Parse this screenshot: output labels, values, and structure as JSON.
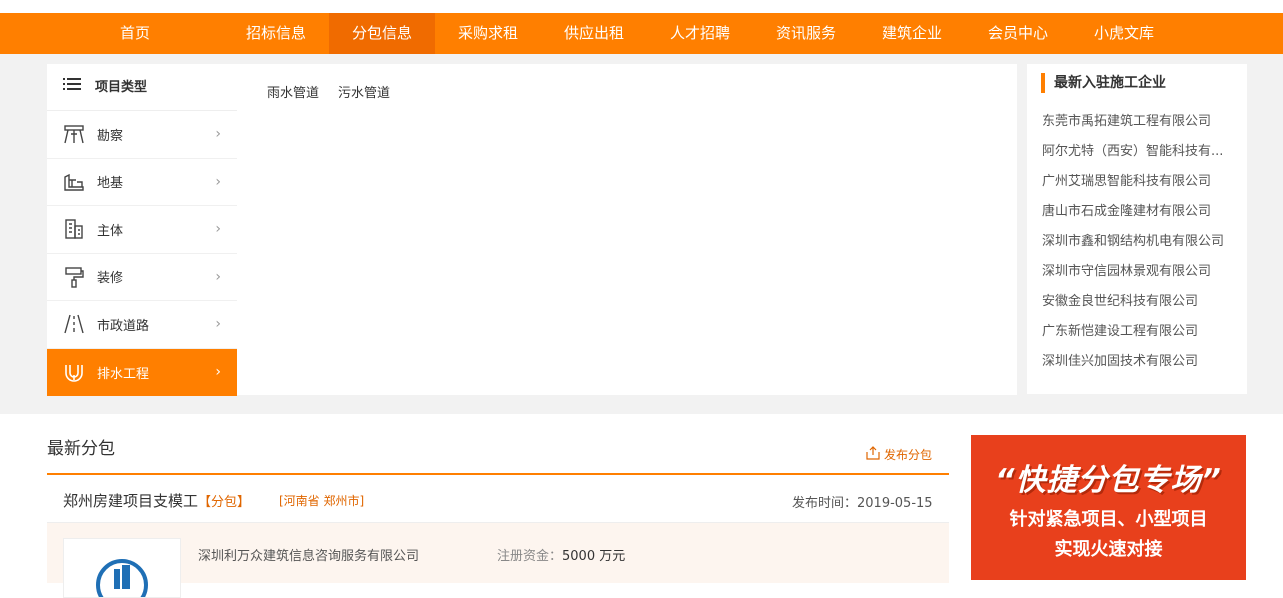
{
  "nav": {
    "items": [
      "首页",
      "招标信息",
      "分包信息",
      "采购求租",
      "供应出租",
      "人才招聘",
      "资讯服务",
      "建筑企业",
      "会员中心",
      "小虎文库"
    ],
    "active_index": 2
  },
  "sidebar": {
    "heading": "项目类型",
    "items": [
      {
        "label": "勘察",
        "icon": "survey-icon"
      },
      {
        "label": "地基",
        "icon": "foundation-icon"
      },
      {
        "label": "主体",
        "icon": "building-icon"
      },
      {
        "label": "装修",
        "icon": "paint-roller-icon"
      },
      {
        "label": "市政道路",
        "icon": "road-icon"
      },
      {
        "label": "排水工程",
        "icon": "drain-pipe-icon"
      }
    ],
    "active_index": 5
  },
  "subcategories": [
    "雨水管道",
    "污水管道"
  ],
  "companies": {
    "title": "最新入驻施工企业",
    "list": [
      "东莞市禹拓建筑工程有限公司",
      "阿尔尤特（西安）智能科技有...",
      "广州艾瑞思智能科技有限公司",
      "唐山市石成金隆建材有限公司",
      "深圳市鑫和钢结构机电有限公司",
      "深圳市守信园林景观有限公司",
      "安徽金良世纪科技有限公司",
      "广东新恺建设工程有限公司",
      "深圳佳兴加固技术有限公司"
    ]
  },
  "latest": {
    "title": "最新分包",
    "publish_label": "发布分包",
    "item": {
      "title": "郑州房建项目支模工",
      "tag": "【分包】",
      "location": "[河南省 郑州市]",
      "date_label": "发布时间：",
      "date": "2019-05-15",
      "company": "深圳利万众建筑信息咨询服务有限公司",
      "capital_label": "注册资金：",
      "capital_value": "5000 万元"
    }
  },
  "banner": {
    "line1": "“快捷分包专场”",
    "line2": "针对紧急项目、小型项目",
    "line3": "实现火速对接"
  },
  "colors": {
    "accent": "#ff7f00",
    "banner_bg": "#e8401c"
  }
}
